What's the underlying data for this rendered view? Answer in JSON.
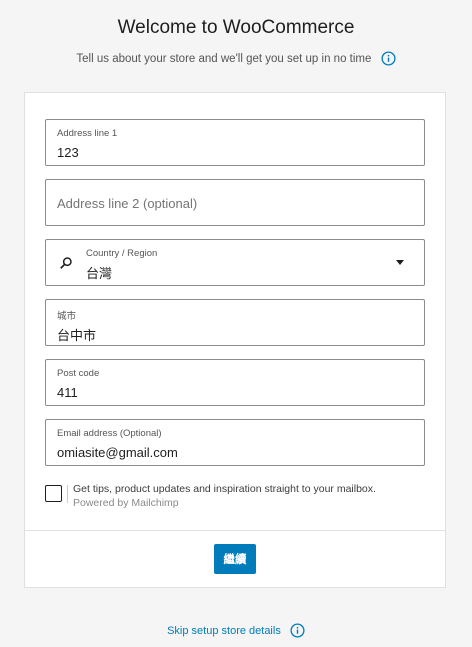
{
  "header": {
    "title": "Welcome to WooCommerce",
    "subtitle": "Tell us about your store and we'll get you set up in no time"
  },
  "form": {
    "address1": {
      "label": "Address line 1",
      "value": "123"
    },
    "address2": {
      "placeholder": "Address line 2 (optional)"
    },
    "country": {
      "label": "Country / Region",
      "value": "台灣"
    },
    "city": {
      "label": "城市",
      "value": "台中市"
    },
    "postcode": {
      "label": "Post code",
      "value": "411"
    },
    "email": {
      "label": "Email address (Optional)",
      "value": "omiasite@gmail.com"
    },
    "newsletter": {
      "label": "Get tips, product updates and inspiration straight to your mailbox.",
      "sublabel": "Powered by Mailchimp",
      "checked": false
    },
    "continue_label": "繼續"
  },
  "footer": {
    "skip_label": "Skip setup store details"
  },
  "colors": {
    "accent": "#007cba",
    "background": "#f5f5f5"
  }
}
